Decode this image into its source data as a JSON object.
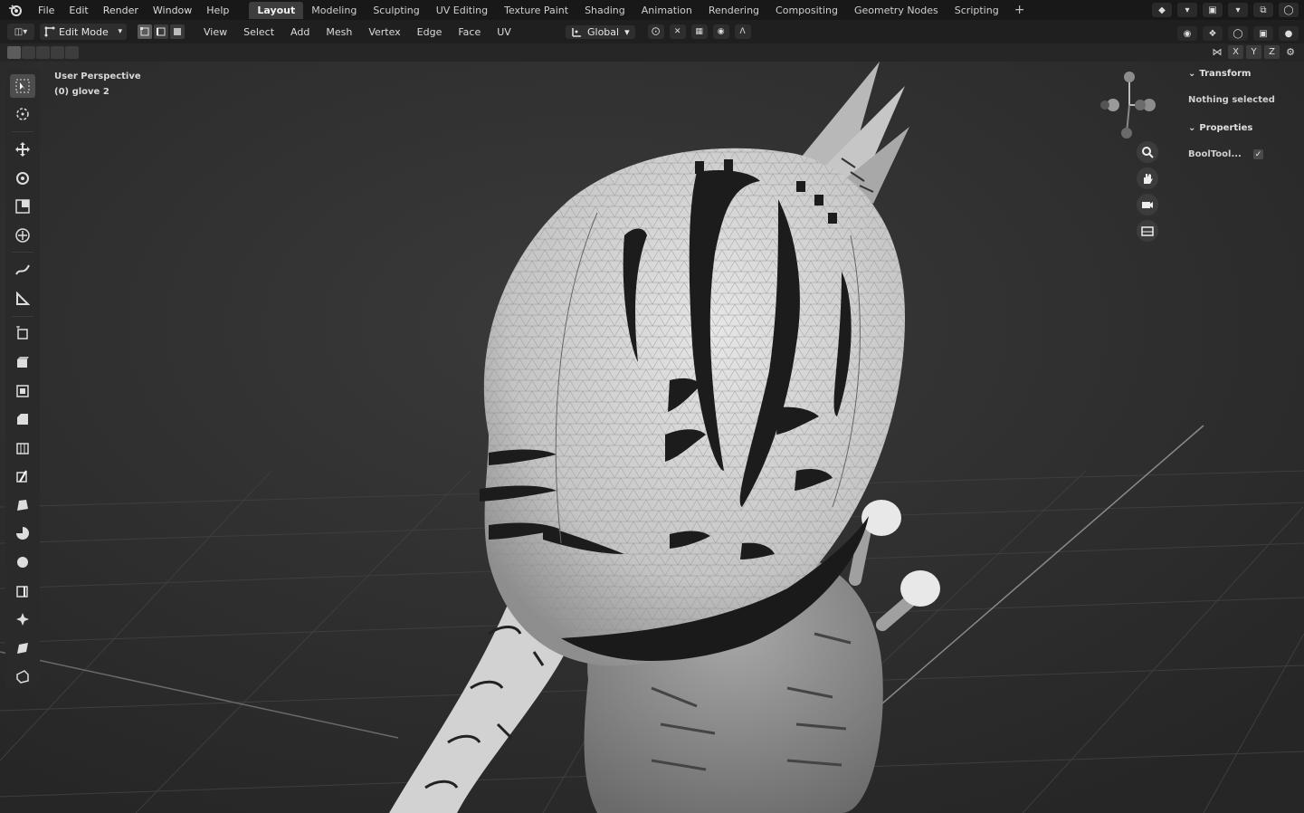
{
  "menu": [
    "File",
    "Edit",
    "Render",
    "Window",
    "Help"
  ],
  "workspaces": [
    {
      "label": "Layout",
      "active": true
    },
    {
      "label": "Modeling",
      "active": false
    },
    {
      "label": "Sculpting",
      "active": false
    },
    {
      "label": "UV Editing",
      "active": false
    },
    {
      "label": "Texture Paint",
      "active": false
    },
    {
      "label": "Shading",
      "active": false
    },
    {
      "label": "Animation",
      "active": false
    },
    {
      "label": "Rendering",
      "active": false
    },
    {
      "label": "Compositing",
      "active": false
    },
    {
      "label": "Geometry Nodes",
      "active": false
    },
    {
      "label": "Scripting",
      "active": false
    }
  ],
  "workspace_add": "+",
  "header": {
    "mode": "Edit Mode",
    "menus": [
      "View",
      "Select",
      "Add",
      "Mesh",
      "Vertex",
      "Edge",
      "Face",
      "UV"
    ],
    "orientation": "Global"
  },
  "toolsettings": {
    "axes": [
      "X",
      "Y",
      "Z"
    ]
  },
  "viewport": {
    "view_name": "User Perspective",
    "object_info": "(0) glove 2"
  },
  "sidebar_panel": {
    "transform_header": "Transform",
    "transform_text": "Nothing selected",
    "properties_header": "Properties",
    "booltool_label": "BoolTool..."
  },
  "colors": {
    "background": "#2b2b2b",
    "topbar": "#181818",
    "mesh": "#cfcfcf",
    "accent": "#5a5a5a"
  }
}
